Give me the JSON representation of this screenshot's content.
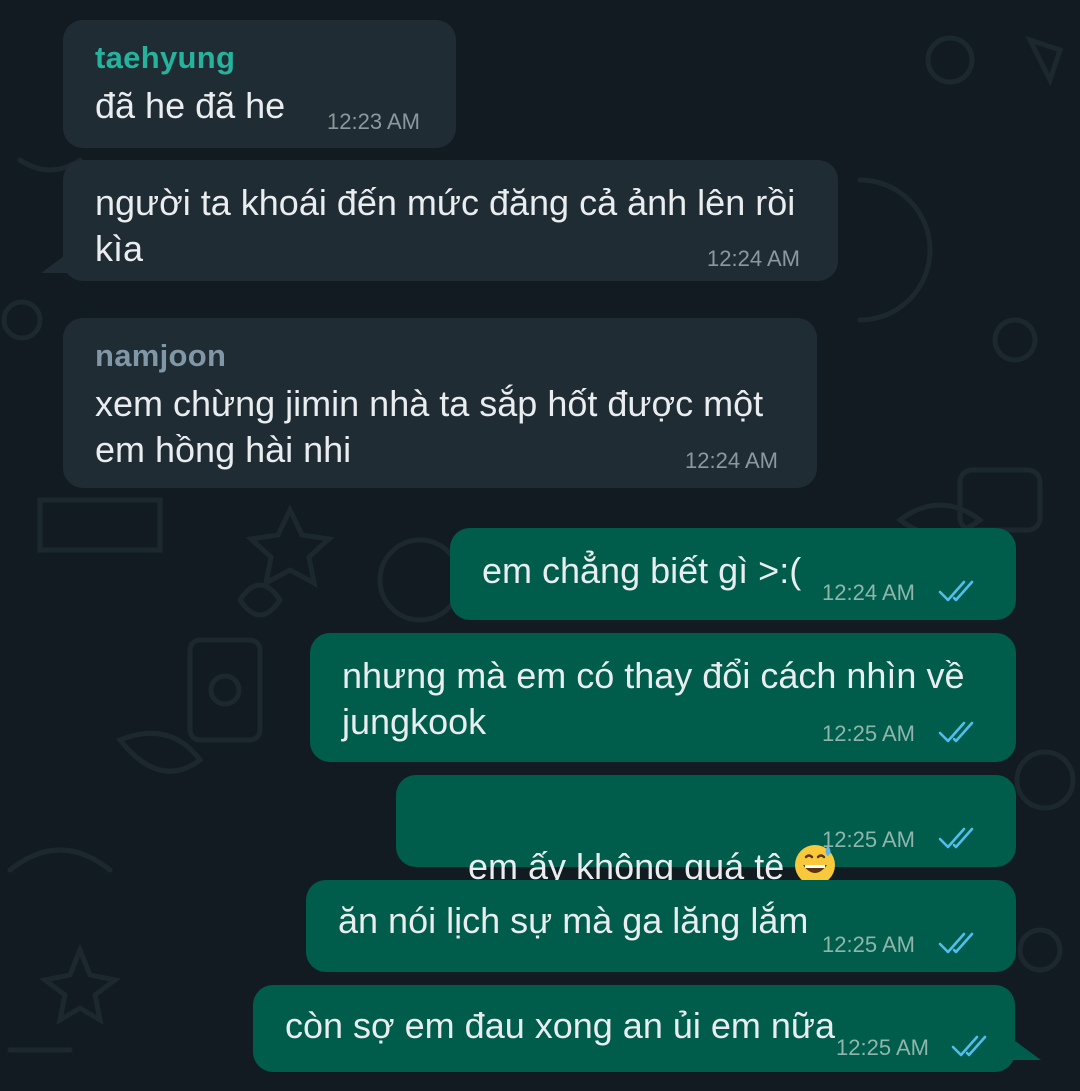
{
  "messages": [
    {
      "sender": "taehyung",
      "sender_color": "#25b39e",
      "text": "đã he đã he",
      "time": "12:23 AM"
    },
    {
      "text": "người ta khoái đến mức đăng cả ảnh lên rồi\nkìa",
      "time": "12:24 AM"
    },
    {
      "sender": "namjoon",
      "sender_color": "#7f97a6",
      "text": "xem chừng jimin nhà ta sắp hốt được một\nem hồng hài nhi",
      "time": "12:24 AM"
    },
    {
      "text": "em chẳng biết gì >:(",
      "time": "12:24 AM",
      "status": "read-double-tick"
    },
    {
      "text": "nhưng mà em có thay đổi cách nhìn về\njungkook",
      "time": "12:25 AM",
      "status": "read-double-tick"
    },
    {
      "text": "em ấy không quá tệ",
      "emoji": "grinning-face-with-sweat-icon",
      "time": "12:25 AM",
      "status": "read-double-tick"
    },
    {
      "text": "ăn nói lịch sự mà ga lăng lắm",
      "time": "12:25 AM",
      "status": "read-double-tick"
    },
    {
      "text": "còn sợ em đau xong an ủi em nữa",
      "time": "12:25 AM",
      "status": "read-double-tick"
    }
  ],
  "colors": {
    "background": "#111b21",
    "incoming_bubble": "#202c33",
    "outgoing_bubble": "#005c4b",
    "read_tick": "#53bdeb"
  }
}
